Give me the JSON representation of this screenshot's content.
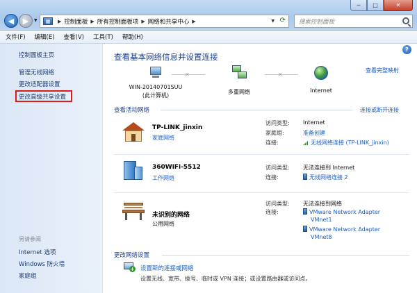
{
  "window": {
    "controls": {
      "minimize": "─",
      "maximize": "□",
      "close": "✕"
    },
    "breadcrumbs": [
      "控制面板",
      "所有控制面板项",
      "网络和共享中心"
    ],
    "search_placeholder": "搜索控制面板"
  },
  "menu": [
    "文件(F)",
    "编辑(E)",
    "查看(V)",
    "工具(T)",
    "帮助(H)"
  ],
  "sidebar": {
    "home": "控制面板主页",
    "links": [
      "管理无线网络",
      "更改适配器设置",
      "更改高级共享设置"
    ],
    "highlighted_link_index": 2,
    "see_also_title": "另请参阅",
    "see_also": [
      "Internet 选项",
      "Windows 防火墙",
      "家庭组"
    ]
  },
  "main": {
    "help": "?",
    "title": "查看基本网络信息并设置连接",
    "full_map": "查看完整映射",
    "map": {
      "computer": "WIN-20140701SUU",
      "computer_sub": "(此计算机)",
      "middle": "多重网络",
      "internet": "Internet",
      "connector": "✕"
    },
    "active_title": "查看活动网络",
    "connect_link": "连接或断开连接",
    "labels": {
      "access_type": "访问类型:",
      "homegroup": "家庭组:",
      "connection": "连接:"
    },
    "networks": [
      {
        "name": "TP-LINK_jinxin",
        "type": "家庭网络",
        "icon": "house-icon",
        "access": "Internet",
        "homegroup": "准备创建",
        "connection": "无线网络连接 (TP-LINK_jinxin)"
      },
      {
        "name": "360WiFi-5512",
        "type": "工作网络",
        "icon": "building-icon",
        "access": "无法连接到 Internet",
        "connection": "无线网络连接 2"
      },
      {
        "name": "未识别的网络",
        "type": "公用网络",
        "icon": "bench-icon",
        "access": "无法连接到网络",
        "connection_lines": [
          "VMware Network Adapter",
          "VMnet1",
          "VMware Network Adapter",
          "VMnet8"
        ]
      }
    ],
    "change_title": "更改网络设置",
    "setup_link": "设置新的连接或网络",
    "setup_desc": "设置无线、宽带、拨号、临时或 VPN 连接；或设置路由器或访问点。",
    "colors": {
      "link": "#1d5ec2",
      "heading": "#1c3d8c",
      "highlight_box": "#e01818"
    }
  }
}
